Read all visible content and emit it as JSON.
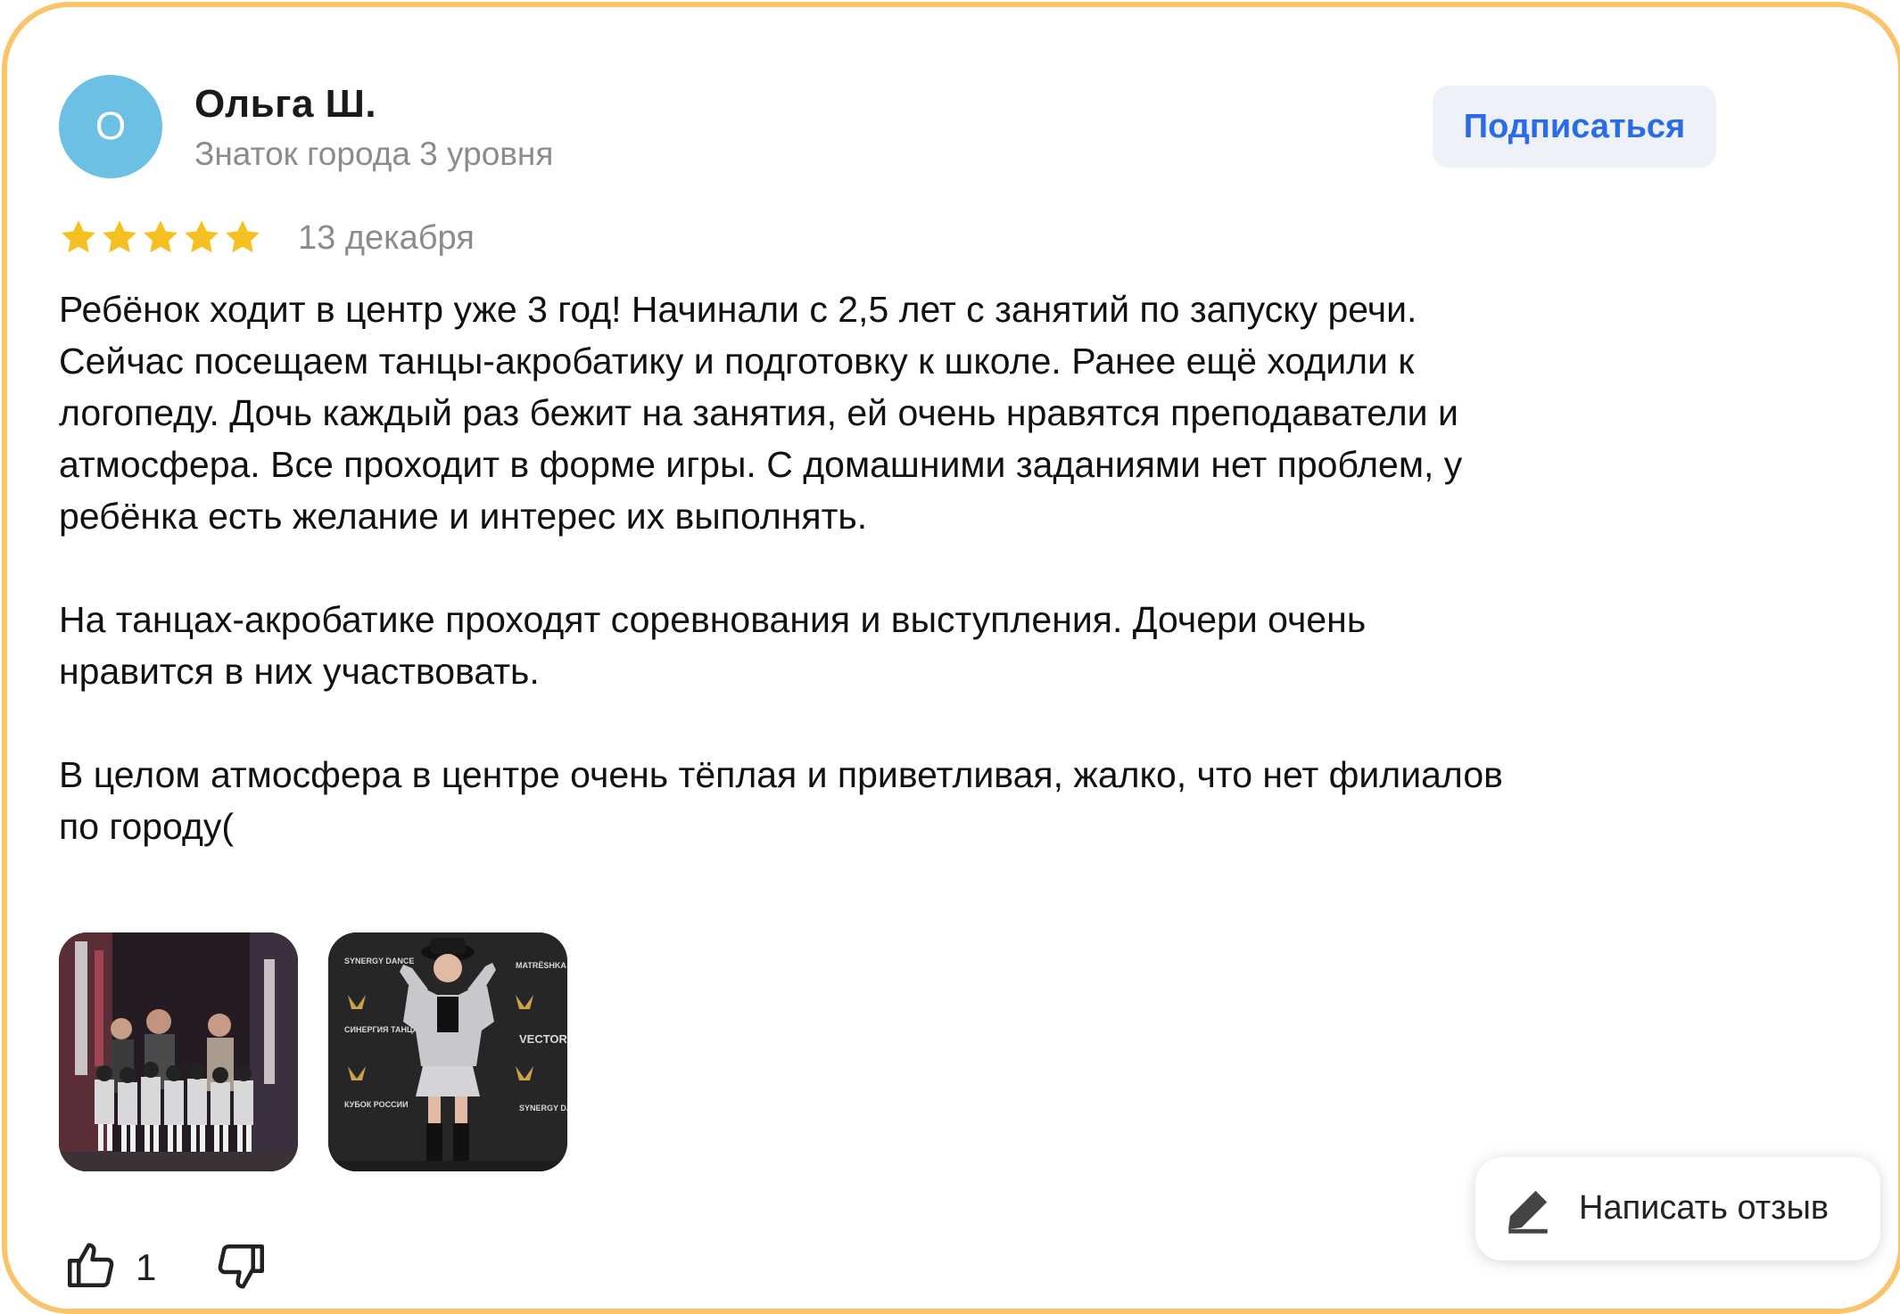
{
  "author": {
    "avatar_letter": "О",
    "avatar_color": "#6CC0E4",
    "name": "Ольга Ш.",
    "level": "Знаток города 3 уровня"
  },
  "subscribe_label": "Подписаться",
  "rating": {
    "stars": 5,
    "max": 5,
    "star_color": "#F5C122"
  },
  "date": "13 декабря",
  "review": {
    "paragraphs": [
      [
        "Ребёнок ходит в центр уже 3 год! Начинали с 2,5 лет с занятий по запуску речи.",
        "Сейчас посещаем танцы-акробатику и подготовку к школе. Ранее ещё ходили к",
        "логопеду. Дочь каждый раз бежит на занятия, ей очень нравятся преподаватели и",
        "атмосфера. Все проходит в форме игры. С домашними заданиями нет проблем, у",
        "ребёнка есть желание и интерес их выполнять."
      ],
      [
        "На танцах-акробатике проходят соревнования и выступления. Дочери очень",
        "нравится в них участвовать."
      ],
      [
        "В целом атмосфера в центре очень тёплая и приветливая, жалко, что нет филиалов",
        "по городу("
      ]
    ]
  },
  "photos": [
    {
      "name": "review-photo-group"
    },
    {
      "name": "review-photo-girl"
    }
  ],
  "photo2_texts": {
    "left_top": "SYNERGY DANCE",
    "left_mid": "СИНЕРГИЯ ТАНЦА",
    "left_bottom": "КУБОК РОССИИ",
    "right_top": "MATRËSHKA",
    "right_mid": "VECTOR",
    "right_bottom": "SYNERGY DANCE"
  },
  "likes": {
    "count": "1"
  },
  "write_review_label": "Написать отзыв",
  "icons": {
    "like": "thumbs-up-icon",
    "dislike": "thumbs-down-icon",
    "pen": "pencil-icon",
    "star": "star-icon"
  }
}
